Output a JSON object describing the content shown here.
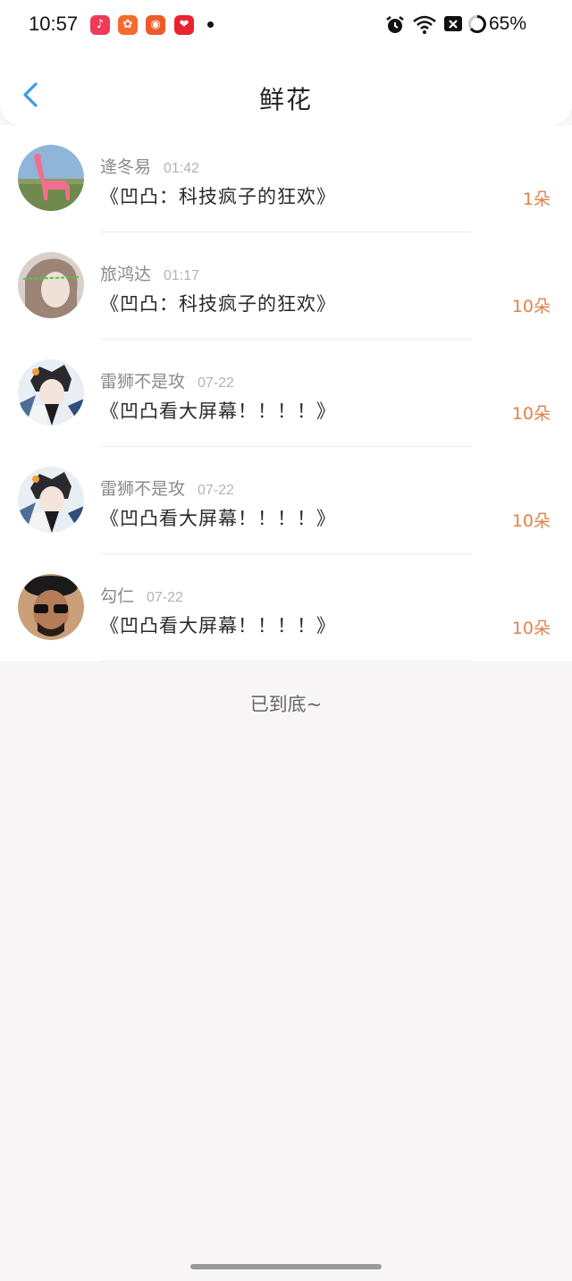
{
  "status_bar": {
    "time": "10:57",
    "battery": "65%",
    "app_icons": [
      {
        "name": "music-app-icon",
        "glyph": "♪",
        "color": "#ef3b5a"
      },
      {
        "name": "shopping-app-icon",
        "glyph": "✿",
        "color": "#f36b2f"
      },
      {
        "name": "food-app-icon",
        "glyph": "◉",
        "color": "#f05a2a"
      },
      {
        "name": "heart-app-icon",
        "glyph": "❤",
        "color": "#e8232f"
      }
    ]
  },
  "header": {
    "title": "鲜花"
  },
  "list": [
    {
      "name": "逄冬易",
      "time": "01:42",
      "message": "《凹凸：科技疯子的狂欢》",
      "quantity": "1朵",
      "avatar": "llama"
    },
    {
      "name": "旅鸿达",
      "time": "01:17",
      "message": "《凹凸：科技疯子的狂欢》",
      "quantity": "10朵",
      "avatar": "girl"
    },
    {
      "name": "雷狮不是攻",
      "time": "07-22",
      "message": "《凹凸看大屏幕！！！！》",
      "quantity": "10朵",
      "avatar": "anime"
    },
    {
      "name": "雷狮不是攻",
      "time": "07-22",
      "message": "《凹凸看大屏幕！！！！》",
      "quantity": "10朵",
      "avatar": "anime"
    },
    {
      "name": "勾仁",
      "time": "07-22",
      "message": "《凹凸看大屏幕！！！！》",
      "quantity": "10朵",
      "avatar": "man"
    }
  ],
  "footer": {
    "end_text": "已到底~"
  },
  "colors": {
    "accent": "#3a9ee8",
    "quantity": "#e0824a",
    "background": "#f8f6f7"
  }
}
